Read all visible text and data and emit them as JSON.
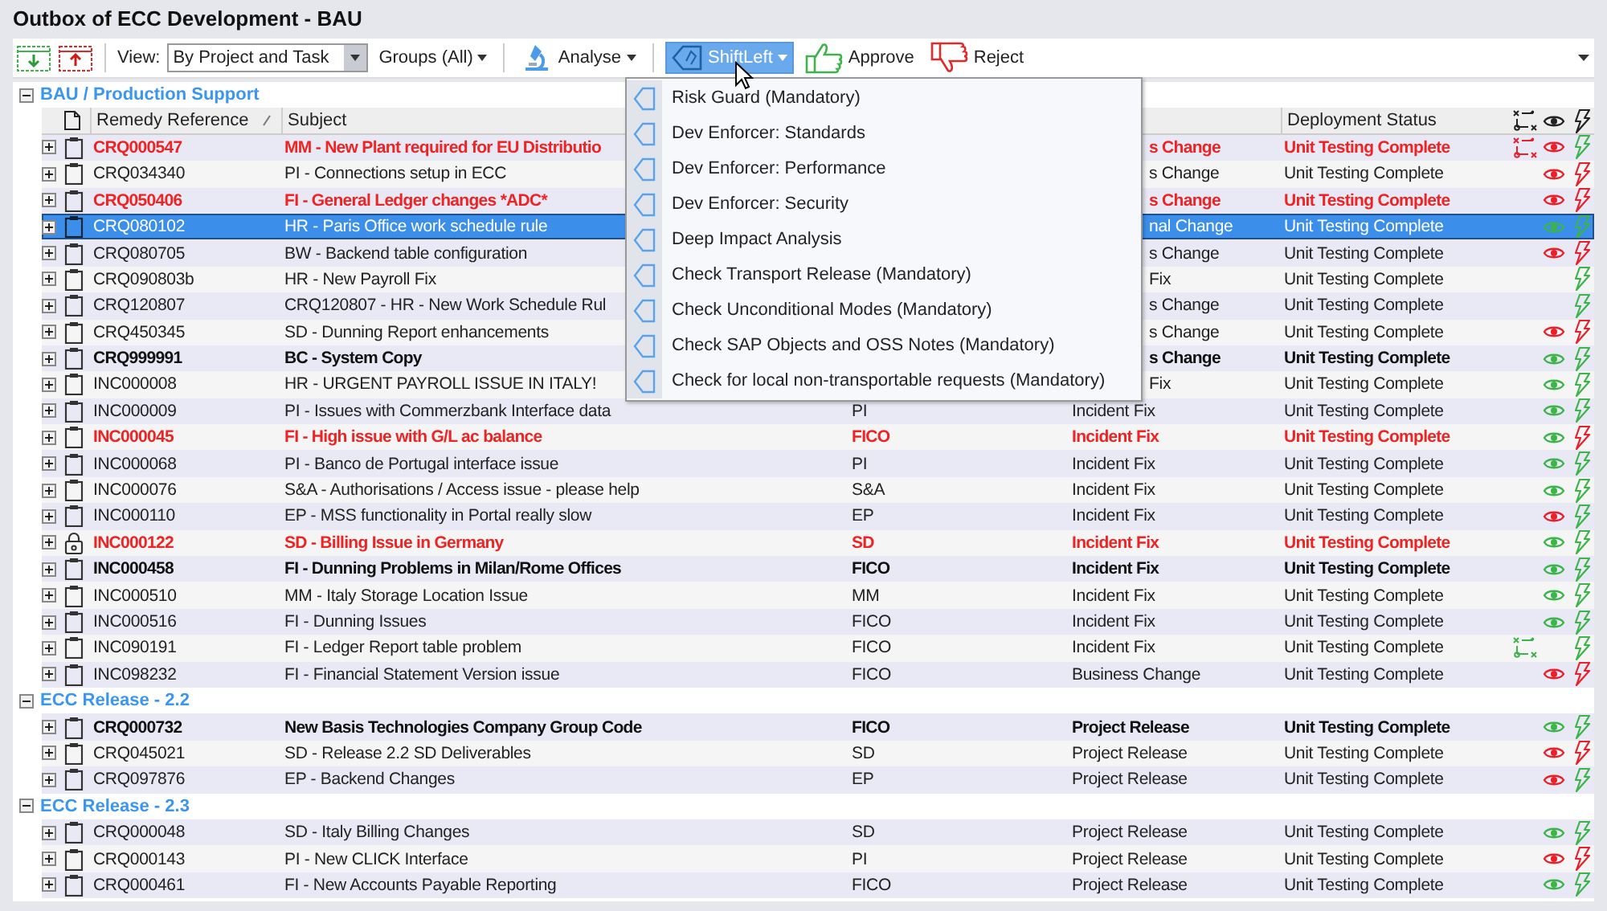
{
  "window": {
    "title": "Outbox of ECC Development - BAU"
  },
  "toolbar": {
    "view_label": "View:",
    "view_value": "By Project and Task",
    "groups": "Groups (All)",
    "analyse": "Analyse",
    "shiftleft": {
      "label": "ShiftLeft",
      "selected": true
    },
    "approve": "Approve",
    "reject": "Reject"
  },
  "table": {
    "columns": {
      "remedy_reference": "Remedy Reference",
      "subject": "Subject",
      "deployment_status": "Deployment Status"
    },
    "groups": [
      {
        "name": "BAU / Production Support",
        "expanded": true,
        "rows": [
          {
            "reference": "CRQ000547",
            "subject": "MM - New Plant required for EU Distributio",
            "column_4": "s Change",
            "deployment_status": "Unit Testing Complete",
            "flagged": true,
            "bold": true,
            "selected": false,
            "locked": false,
            "transport": {
              "color": "#e8202a"
            },
            "eye": {
              "color": "#e8202a"
            },
            "bolt": {
              "color": "#3cb44a"
            }
          },
          {
            "reference": "CRQ034340",
            "subject": "PI - Connections setup in ECC",
            "column_4": "s Change",
            "deployment_status": "Unit Testing Complete",
            "flagged": false,
            "bold": false,
            "selected": false,
            "locked": false,
            "eye": {
              "color": "#e8202a"
            },
            "bolt": {
              "color": "#e8202a"
            }
          },
          {
            "reference": "CRQ050406",
            "subject": "FI - General Ledger changes *ADC*",
            "column_4": "s Change",
            "deployment_status": "Unit Testing Complete",
            "flagged": true,
            "bold": true,
            "selected": false,
            "locked": false,
            "eye": {
              "color": "#e8202a"
            },
            "bolt": {
              "color": "#e8202a"
            }
          },
          {
            "reference": "CRQ080102",
            "subject": "HR - Paris Office work schedule rule",
            "column_4": "nal Change",
            "deployment_status": "Unit Testing Complete",
            "flagged": false,
            "bold": false,
            "selected": true,
            "locked": false,
            "eye": {
              "color": "#3cb44a"
            },
            "bolt": {
              "color": "#3cb44a"
            }
          },
          {
            "reference": "CRQ080705",
            "subject": "BW - Backend table configuration",
            "column_4": "s Change",
            "deployment_status": "Unit Testing Complete",
            "flagged": false,
            "bold": false,
            "selected": false,
            "locked": false,
            "eye": {
              "color": "#e8202a"
            },
            "bolt": {
              "color": "#e8202a"
            }
          },
          {
            "reference": "CRQ090803b",
            "subject": "HR - New Payroll Fix",
            "column_4": "Fix",
            "deployment_status": "Unit Testing Complete",
            "flagged": false,
            "bold": false,
            "selected": false,
            "locked": false,
            "bolt": {
              "color": "#3cb44a"
            }
          },
          {
            "reference": "CRQ120807",
            "subject": "CRQ120807 - HR - New Work Schedule Rul",
            "column_4": "s Change",
            "deployment_status": "Unit Testing Complete",
            "flagged": false,
            "bold": false,
            "selected": false,
            "locked": false,
            "bolt": {
              "color": "#3cb44a"
            }
          },
          {
            "reference": "CRQ450345",
            "subject": "SD - Dunning Report enhancements",
            "column_4": "s Change",
            "deployment_status": "Unit Testing Complete",
            "flagged": false,
            "bold": false,
            "selected": false,
            "locked": false,
            "eye": {
              "color": "#e8202a"
            },
            "bolt": {
              "color": "#e8202a"
            }
          },
          {
            "reference": "CRQ999991",
            "subject": "BC - System Copy",
            "column_4": "s Change",
            "deployment_status": "Unit Testing Complete",
            "flagged": false,
            "bold": true,
            "selected": false,
            "locked": false,
            "eye": {
              "color": "#3cb44a"
            },
            "bolt": {
              "color": "#3cb44a"
            }
          },
          {
            "reference": "INC000008",
            "subject": "HR - URGENT PAYROLL ISSUE IN ITALY!",
            "column_4": "Fix",
            "deployment_status": "Unit Testing Complete",
            "flagged": false,
            "bold": false,
            "selected": false,
            "locked": false,
            "eye": {
              "color": "#3cb44a"
            },
            "bolt": {
              "color": "#3cb44a"
            }
          },
          {
            "reference": "INC000009",
            "subject": "PI - Issues with Commerzbank Interface data",
            "column_3": "PI",
            "column_4": "Incident Fix",
            "deployment_status": "Unit Testing Complete",
            "flagged": false,
            "bold": false,
            "selected": false,
            "locked": false,
            "eye": {
              "color": "#3cb44a"
            },
            "bolt": {
              "color": "#3cb44a"
            }
          },
          {
            "reference": "INC000045",
            "subject": "FI - High issue with G/L ac balance",
            "column_3": "FICO",
            "column_4": "Incident Fix",
            "deployment_status": "Unit Testing Complete",
            "flagged": true,
            "bold": true,
            "selected": false,
            "locked": false,
            "eye": {
              "color": "#3cb44a"
            },
            "bolt": {
              "color": "#e8202a"
            }
          },
          {
            "reference": "INC000068",
            "subject": "PI - Banco de Portugal interface issue",
            "column_3": "PI",
            "column_4": "Incident Fix",
            "deployment_status": "Unit Testing Complete",
            "flagged": false,
            "bold": false,
            "selected": false,
            "locked": false,
            "eye": {
              "color": "#3cb44a"
            },
            "bolt": {
              "color": "#3cb44a"
            }
          },
          {
            "reference": "INC000076",
            "subject": "S&A - Authorisations / Access issue - please help",
            "column_3": "S&A",
            "column_4": "Incident Fix",
            "deployment_status": "Unit Testing Complete",
            "flagged": false,
            "bold": false,
            "selected": false,
            "locked": false,
            "eye": {
              "color": "#3cb44a"
            },
            "bolt": {
              "color": "#3cb44a"
            }
          },
          {
            "reference": "INC000110",
            "subject": "EP - MSS functionality in Portal really slow",
            "column_3": "EP",
            "column_4": "Incident Fix",
            "deployment_status": "Unit Testing Complete",
            "flagged": false,
            "bold": false,
            "selected": false,
            "locked": false,
            "eye": {
              "color": "#e8202a"
            },
            "bolt": {
              "color": "#3cb44a"
            }
          },
          {
            "reference": "INC000122",
            "subject": "SD - Billing Issue in Germany",
            "column_3": "SD",
            "column_4": "Incident Fix",
            "deployment_status": "Unit Testing Complete",
            "flagged": true,
            "bold": true,
            "selected": false,
            "locked": true,
            "eye": {
              "color": "#3cb44a"
            },
            "bolt": {
              "color": "#3cb44a"
            }
          },
          {
            "reference": "INC000458",
            "subject": "FI - Dunning Problems in Milan/Rome Offices",
            "column_3": "FICO",
            "column_4": "Incident Fix",
            "deployment_status": "Unit Testing Complete",
            "flagged": false,
            "bold": true,
            "selected": false,
            "locked": false,
            "eye": {
              "color": "#3cb44a"
            },
            "bolt": {
              "color": "#3cb44a"
            }
          },
          {
            "reference": "INC000510",
            "subject": "MM - Italy Storage Location Issue",
            "column_3": "MM",
            "column_4": "Incident Fix",
            "deployment_status": "Unit Testing Complete",
            "flagged": false,
            "bold": false,
            "selected": false,
            "locked": false,
            "eye": {
              "color": "#3cb44a"
            },
            "bolt": {
              "color": "#3cb44a"
            }
          },
          {
            "reference": "INC000516",
            "subject": "FI - Dunning Issues",
            "column_3": "FICO",
            "column_4": "Incident Fix",
            "deployment_status": "Unit Testing Complete",
            "flagged": false,
            "bold": false,
            "selected": false,
            "locked": false,
            "eye": {
              "color": "#3cb44a"
            },
            "bolt": {
              "color": "#3cb44a"
            }
          },
          {
            "reference": "INC090191",
            "subject": "FI - Ledger Report table problem",
            "column_3": "FICO",
            "column_4": "Incident Fix",
            "deployment_status": "Unit Testing Complete",
            "flagged": false,
            "bold": false,
            "selected": false,
            "locked": false,
            "transport": {
              "color": "#3cb44a"
            },
            "bolt": {
              "color": "#3cb44a"
            }
          },
          {
            "reference": "INC098232",
            "subject": "FI - Financial Statement Version issue",
            "column_3": "FICO",
            "column_4": "Business Change",
            "deployment_status": "Unit Testing Complete",
            "flagged": false,
            "bold": false,
            "selected": false,
            "locked": false,
            "eye": {
              "color": "#e8202a"
            },
            "bolt": {
              "color": "#e8202a"
            }
          }
        ]
      },
      {
        "name": "ECC Release - 2.2",
        "expanded": true,
        "rows": [
          {
            "reference": "CRQ000732",
            "subject": "New Basis Technologies Company Group Code",
            "column_3": "FICO",
            "column_4": "Project Release",
            "deployment_status": "Unit Testing Complete",
            "flagged": false,
            "bold": true,
            "selected": false,
            "locked": false,
            "eye": {
              "color": "#3cb44a"
            },
            "bolt": {
              "color": "#3cb44a"
            }
          },
          {
            "reference": "CRQ045021",
            "subject": "SD - Release 2.2 SD Deliverables",
            "column_3": "SD",
            "column_4": "Project Release",
            "deployment_status": "Unit Testing Complete",
            "flagged": false,
            "bold": false,
            "selected": false,
            "locked": false,
            "eye": {
              "color": "#e8202a"
            },
            "bolt": {
              "color": "#e8202a"
            }
          },
          {
            "reference": "CRQ097876",
            "subject": "EP - Backend Changes",
            "column_3": "EP",
            "column_4": "Project Release",
            "deployment_status": "Unit Testing Complete",
            "flagged": false,
            "bold": false,
            "selected": false,
            "locked": false,
            "eye": {
              "color": "#e8202a"
            },
            "bolt": {
              "color": "#3cb44a"
            }
          }
        ]
      },
      {
        "name": "ECC Release - 2.3",
        "expanded": true,
        "rows": [
          {
            "reference": "CRQ000048",
            "subject": "SD - Italy Billing Changes",
            "column_3": "SD",
            "column_4": "Project Release",
            "deployment_status": "Unit Testing Complete",
            "flagged": false,
            "bold": false,
            "selected": false,
            "locked": false,
            "eye": {
              "color": "#3cb44a"
            },
            "bolt": {
              "color": "#3cb44a"
            }
          },
          {
            "reference": "CRQ000143",
            "subject": "PI - New CLICK Interface",
            "column_3": "PI",
            "column_4": "Project Release",
            "deployment_status": "Unit Testing Complete",
            "flagged": false,
            "bold": false,
            "selected": false,
            "locked": false,
            "eye": {
              "color": "#e8202a"
            },
            "bolt": {
              "color": "#e8202a"
            }
          },
          {
            "reference": "CRQ000461",
            "subject": "FI - New Accounts Payable Reporting",
            "column_3": "FICO",
            "column_4": "Project Release",
            "deployment_status": "Unit Testing Complete",
            "flagged": false,
            "bold": false,
            "selected": false,
            "locked": false,
            "eye": {
              "color": "#3cb44a"
            },
            "bolt": {
              "color": "#3cb44a"
            }
          }
        ]
      }
    ]
  },
  "shiftleft_menu": {
    "items": [
      "Risk Guard (Mandatory)",
      "Dev Enforcer: Standards",
      "Dev Enforcer: Performance",
      "Dev Enforcer: Security",
      "Deep Impact Analysis",
      "Check Transport Release (Mandatory)",
      "Check Unconditional Modes (Mandatory)",
      "Check SAP Objects and OSS Notes (Mandatory)",
      "Check for local non-transportable requests (Mandatory)"
    ]
  }
}
